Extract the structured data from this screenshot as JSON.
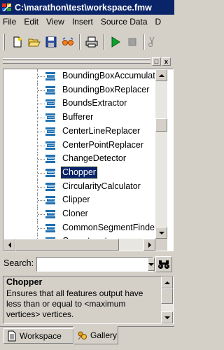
{
  "window": {
    "title": "C:\\marathon\\test\\workspace.fmw",
    "title_bar_color": "#0a246a"
  },
  "menu": [
    "File",
    "Edit",
    "View",
    "Insert",
    "Source Data",
    "D"
  ],
  "toolbar": {
    "buttons": [
      "new-file-icon",
      "open-folder-icon",
      "save-disk-icon",
      "glasses-icon",
      "print-icon",
      "run-play-icon",
      "stop-icon",
      "cut-scissors-icon"
    ]
  },
  "panel": {
    "close_label": "x",
    "restore_label": "□"
  },
  "tree": {
    "items": [
      {
        "label": "BoundingBoxAccumulato"
      },
      {
        "label": "BoundingBoxReplacer"
      },
      {
        "label": "BoundsExtractor"
      },
      {
        "label": "Bufferer"
      },
      {
        "label": "CenterLineReplacer"
      },
      {
        "label": "CenterPointReplacer"
      },
      {
        "label": "ChangeDetector"
      },
      {
        "label": "Chopper",
        "selected": true
      },
      {
        "label": "CircularityCalculator"
      },
      {
        "label": "Clipper"
      },
      {
        "label": "Cloner"
      },
      {
        "label": "CommonSegmentFinder"
      },
      {
        "label": "Concatenator"
      }
    ],
    "selected_color": "#0a246a",
    "icon_color": "#1f6fb0"
  },
  "search": {
    "label": "Search:",
    "value": ""
  },
  "description": {
    "title": "Chopper",
    "text": "Ensures that all features output have less than or equal to <maximum vertices> vertices."
  },
  "tabs": [
    {
      "label": "Workspace",
      "active": false
    },
    {
      "label": "Gallery",
      "active": true
    }
  ]
}
